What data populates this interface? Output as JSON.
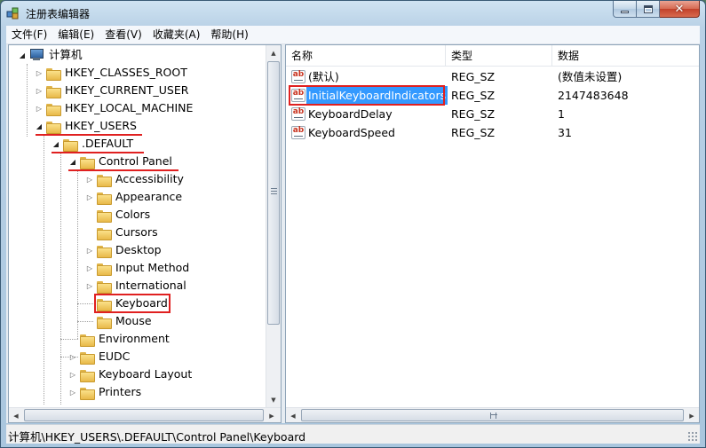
{
  "window": {
    "title": "注册表编辑器",
    "controls": {
      "minimize": "minimize",
      "maximize": "maximize",
      "close": "close"
    }
  },
  "menu": [
    "文件(F)",
    "编辑(E)",
    "查看(V)",
    "收藏夹(A)",
    "帮助(H)"
  ],
  "tree": {
    "root": "计算机",
    "hives": {
      "classes_root": "HKEY_CLASSES_ROOT",
      "current_user": "HKEY_CURRENT_USER",
      "local_machine": "HKEY_LOCAL_MACHINE",
      "users": "HKEY_USERS"
    },
    "default_key": ".DEFAULT",
    "control_panel": "Control Panel",
    "control_panel_children": [
      "Accessibility",
      "Appearance",
      "Colors",
      "Cursors",
      "Desktop",
      "Input Method",
      "International",
      "Keyboard",
      "Mouse"
    ],
    "default_siblings": [
      "Environment",
      "EUDC",
      "Keyboard Layout",
      "Printers"
    ]
  },
  "list": {
    "columns": {
      "name": "名称",
      "type": "类型",
      "data": "数据"
    },
    "rows": [
      {
        "name": "(默认)",
        "type": "REG_SZ",
        "data": "(数值未设置)"
      },
      {
        "name": "InitialKeyboardIndicators",
        "type": "REG_SZ",
        "data": "2147483648"
      },
      {
        "name": "KeyboardDelay",
        "type": "REG_SZ",
        "data": "1"
      },
      {
        "name": "KeyboardSpeed",
        "type": "REG_SZ",
        "data": "31"
      }
    ]
  },
  "status": {
    "path": "计算机\\HKEY_USERS\\.DEFAULT\\Control Panel\\Keyboard"
  },
  "colors": {
    "highlight": "#e02020",
    "selection": "#3399ff"
  }
}
